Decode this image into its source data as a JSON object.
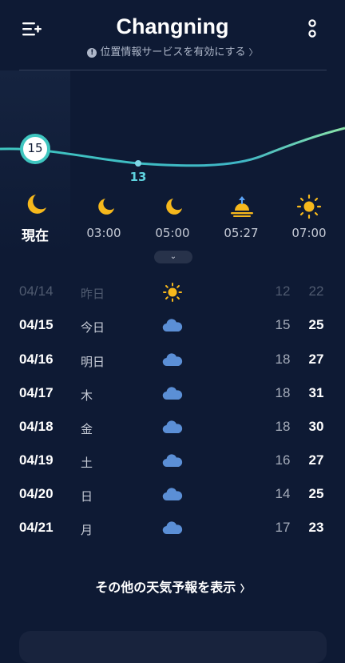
{
  "header": {
    "city": "Changning",
    "location_prompt": "位置情報サービスを有効にする",
    "location_chevron": "〉"
  },
  "hourly": {
    "current_temp": "15",
    "min_temp": "13",
    "items": [
      {
        "label": "現在",
        "icon": "moon-icon"
      },
      {
        "label": "03:00",
        "icon": "moon-icon"
      },
      {
        "label": "05:00",
        "icon": "moon-icon"
      },
      {
        "label": "05:27",
        "icon": "sunrise-icon"
      },
      {
        "label": "07:00",
        "icon": "sun-icon"
      }
    ],
    "expand_glyph": "⌄"
  },
  "daily": [
    {
      "date": "04/14",
      "day": "昨日",
      "icon": "sun-icon",
      "low": "12",
      "high": "22",
      "past": true
    },
    {
      "date": "04/15",
      "day": "今日",
      "icon": "cloud-icon",
      "low": "15",
      "high": "25",
      "past": false
    },
    {
      "date": "04/16",
      "day": "明日",
      "icon": "cloud-icon",
      "low": "18",
      "high": "27",
      "past": false
    },
    {
      "date": "04/17",
      "day": "木",
      "icon": "cloud-icon",
      "low": "18",
      "high": "31",
      "past": false
    },
    {
      "date": "04/18",
      "day": "金",
      "icon": "cloud-icon",
      "low": "18",
      "high": "30",
      "past": false
    },
    {
      "date": "04/19",
      "day": "土",
      "icon": "cloud-icon",
      "low": "16",
      "high": "27",
      "past": false
    },
    {
      "date": "04/20",
      "day": "日",
      "icon": "cloud-icon",
      "low": "14",
      "high": "25",
      "past": false
    },
    {
      "date": "04/21",
      "day": "月",
      "icon": "cloud-icon",
      "low": "17",
      "high": "23",
      "past": false
    }
  ],
  "footer": {
    "more_forecast": "その他の天気予報を表示",
    "more_chevron": "〉"
  },
  "colors": {
    "background": "#0e1a34",
    "accent": "#3fc6c0",
    "sun": "#f6b81c",
    "cloud": "#5b8fd6"
  }
}
